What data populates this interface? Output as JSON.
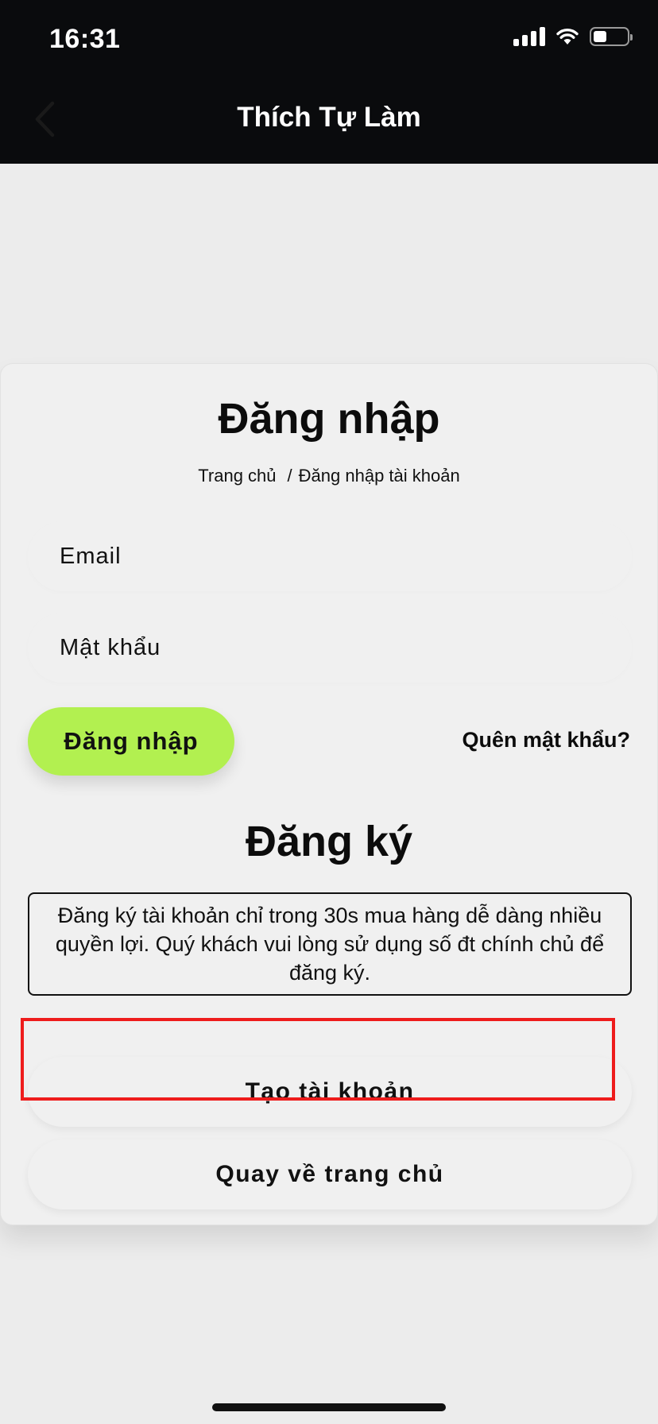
{
  "status_bar": {
    "time": "16:31",
    "icons": [
      "cellular-signal-icon",
      "wifi-icon",
      "battery-icon"
    ],
    "battery_level": 0.35
  },
  "header": {
    "title": "Thích Tự Làm",
    "back_icon": "chevron-left-icon"
  },
  "login": {
    "title": "Đăng nhập",
    "breadcrumb": {
      "home": "Trang chủ",
      "separator": "/",
      "current": "Đăng nhập tài khoản"
    },
    "email_placeholder": "Email",
    "password_placeholder": "Mật khẩu",
    "submit_label": "Đăng nhập",
    "forgot_label": "Quên mật khẩu?"
  },
  "register": {
    "title": "Đăng ký",
    "info_text": "Đăng ký tài khoản chỉ trong 30s mua hàng dễ dàng nhiều quyền lợi. Quý khách vui lòng sử dụng số đt chính chủ để đăng ký.",
    "create_label": "Tạo tài khoản",
    "home_label": "Quay về trang chủ"
  },
  "colors": {
    "header_bg": "#0a0b0d",
    "accent_green": "#b2f050",
    "highlight_red": "#ee1c1c",
    "card_bg": "#f0f0f0"
  }
}
